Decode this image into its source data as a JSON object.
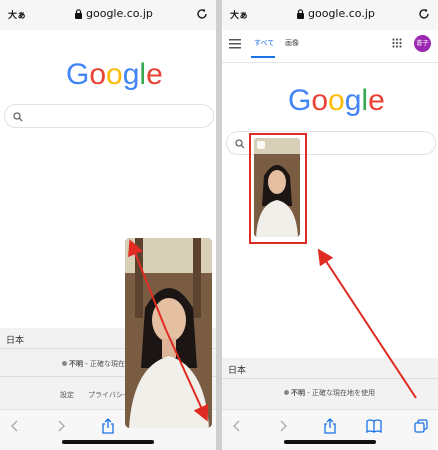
{
  "left": {
    "url_bar": {
      "text_size_label": "大ぁ",
      "url": "google.co.jp"
    },
    "logo": [
      "G",
      "o",
      "o",
      "g",
      "l",
      "e"
    ],
    "region": "日本",
    "location_bold": "不明",
    "location_text": " - 正確な現在地",
    "footer_links": [
      "設定",
      "プライバシー"
    ]
  },
  "right": {
    "url_bar": {
      "text_size_label": "大ぁ",
      "url": "google.co.jp"
    },
    "tabs": [
      "すべて",
      "画像"
    ],
    "avatar_label": "蒼子",
    "logo": [
      "G",
      "o",
      "o",
      "g",
      "l",
      "e"
    ],
    "region": "日本",
    "location_bold": "不明",
    "location_text": " - 正確な現在地を使用"
  },
  "colors": {
    "google_blue": "#4285F4",
    "google_red": "#EA4335",
    "google_yellow": "#FBBC05",
    "google_green": "#34A853",
    "accent_blue": "#1a73e8",
    "avatar_purple": "#9c27b0",
    "annotation_red": "#e02b22"
  }
}
